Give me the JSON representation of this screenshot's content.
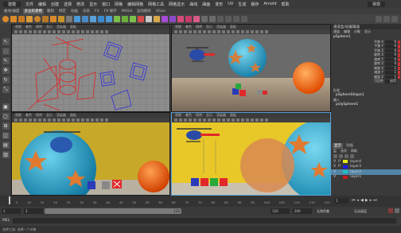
{
  "menubar": {
    "workspace": "建模",
    "items": [
      "文件",
      "编辑",
      "创建",
      "选择",
      "修改",
      "显示",
      "窗口",
      "网格",
      "编辑网格",
      "网格工具",
      "网格显示",
      "曲线",
      "曲面",
      "变形",
      "UV",
      "生成",
      "缓存",
      "Arnold",
      "帮助"
    ],
    "right_workspace": "常规"
  },
  "shelf_tabs": [
    "曲线/曲面",
    "多边形建模",
    "雕刻",
    "绑定",
    "动画",
    "渲染",
    "FX",
    "FX 缓存",
    "MASH",
    "运动图形",
    "XGen"
  ],
  "shelf_active": "多边形建模",
  "viewport_menu": [
    "视图",
    "着色",
    "照明",
    "显示",
    "渲染器",
    "面板"
  ],
  "channelbox": {
    "header": "通道盒/层编辑器",
    "menu": [
      "通道",
      "编辑",
      "对象",
      "显示"
    ],
    "object": "pSphere1",
    "channels": [
      {
        "label": "平移 X",
        "value": "0"
      },
      {
        "label": "平移 Y",
        "value": "0"
      },
      {
        "label": "平移 Z",
        "value": "0"
      },
      {
        "label": "旋转 X",
        "value": "0"
      },
      {
        "label": "旋转 Y",
        "value": "0"
      },
      {
        "label": "旋转 Z",
        "value": "0"
      },
      {
        "label": "缩放 X",
        "value": "1"
      },
      {
        "label": "缩放 Y",
        "value": "1"
      },
      {
        "label": "缩放 Z",
        "value": "1"
      },
      {
        "label": "可见性",
        "value": "启用"
      }
    ],
    "shapes_label": "形状",
    "shape_node": "pSphereShape1",
    "inputs_label": "输入",
    "input_node": "polySphere1"
  },
  "layers": {
    "tabs": [
      "显示",
      "动画"
    ],
    "menu": [
      "层",
      "选项",
      "帮助"
    ],
    "items": [
      {
        "v": "V",
        "p": "P",
        "name": "layer4",
        "color": "#e8e81a",
        "selected": false
      },
      {
        "v": "V",
        "p": "P",
        "name": "layer3",
        "color": "#1a1ae8",
        "selected": false
      },
      {
        "v": "V",
        "p": "",
        "name": "layer2",
        "color": "#1ac4c4",
        "selected": true
      },
      {
        "v": "V",
        "p": "",
        "name": "layer1",
        "color": "#c41a1a",
        "selected": false
      }
    ]
  },
  "timeline": {
    "ticks": [
      "5",
      "10",
      "15",
      "20",
      "25",
      "30",
      "35",
      "40",
      "45",
      "50",
      "55",
      "60",
      "65",
      "70",
      "75",
      "80",
      "85",
      "90",
      "95",
      "100",
      "105",
      "110",
      "115",
      "120"
    ],
    "current_frame": "1"
  },
  "range": {
    "start": "1",
    "playback_start": "1",
    "range_end_label": "120",
    "end": "120",
    "anim_end": "200",
    "char_set": "无角色集",
    "anim_layer": "无动画层"
  },
  "cmdline": {
    "label": "MEL"
  },
  "helpline": {
    "text": "选择工具: 选择一个对象"
  }
}
